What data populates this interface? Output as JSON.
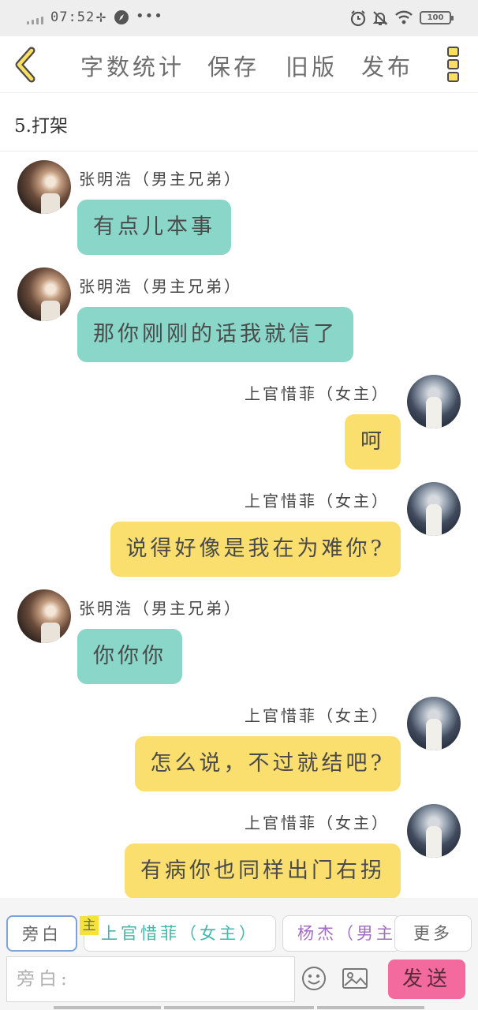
{
  "status_bar": {
    "time": "07:52",
    "dots": "•••",
    "battery": "100"
  },
  "toolbar": {
    "items": [
      "字数统计",
      "保存",
      "旧版",
      "发布"
    ]
  },
  "chapter": {
    "title": "5.打架"
  },
  "messages": [
    {
      "side": "left",
      "speaker": "张明浩（男主兄弟）",
      "text": "有点儿本事"
    },
    {
      "side": "left",
      "speaker": "张明浩（男主兄弟）",
      "text": "那你刚刚的话我就信了"
    },
    {
      "side": "right",
      "speaker": "上官惜菲（女主）",
      "text": "呵"
    },
    {
      "side": "right",
      "speaker": "上官惜菲（女主）",
      "text": "说得好像是我在为难你?"
    },
    {
      "side": "left",
      "speaker": "张明浩（男主兄弟）",
      "text": "你你你"
    },
    {
      "side": "right",
      "speaker": "上官惜菲（女主）",
      "text": "怎么说，不过就结吧?"
    },
    {
      "side": "right",
      "speaker": "上官惜菲（女主）",
      "text": "有病你也同样出门右拐"
    }
  ],
  "roles": {
    "narrator": "旁白",
    "main_tag": "主",
    "main": "上官惜菲（女主）",
    "yang": "杨杰（男主",
    "more": "更多"
  },
  "input": {
    "placeholder": "旁白:",
    "send": "发送"
  },
  "colors": {
    "left_bubble": "#8ad6c9",
    "right_bubble": "#fbdf6e",
    "send_button": "#f26a9e",
    "accent_yellow": "#fbdf63"
  }
}
